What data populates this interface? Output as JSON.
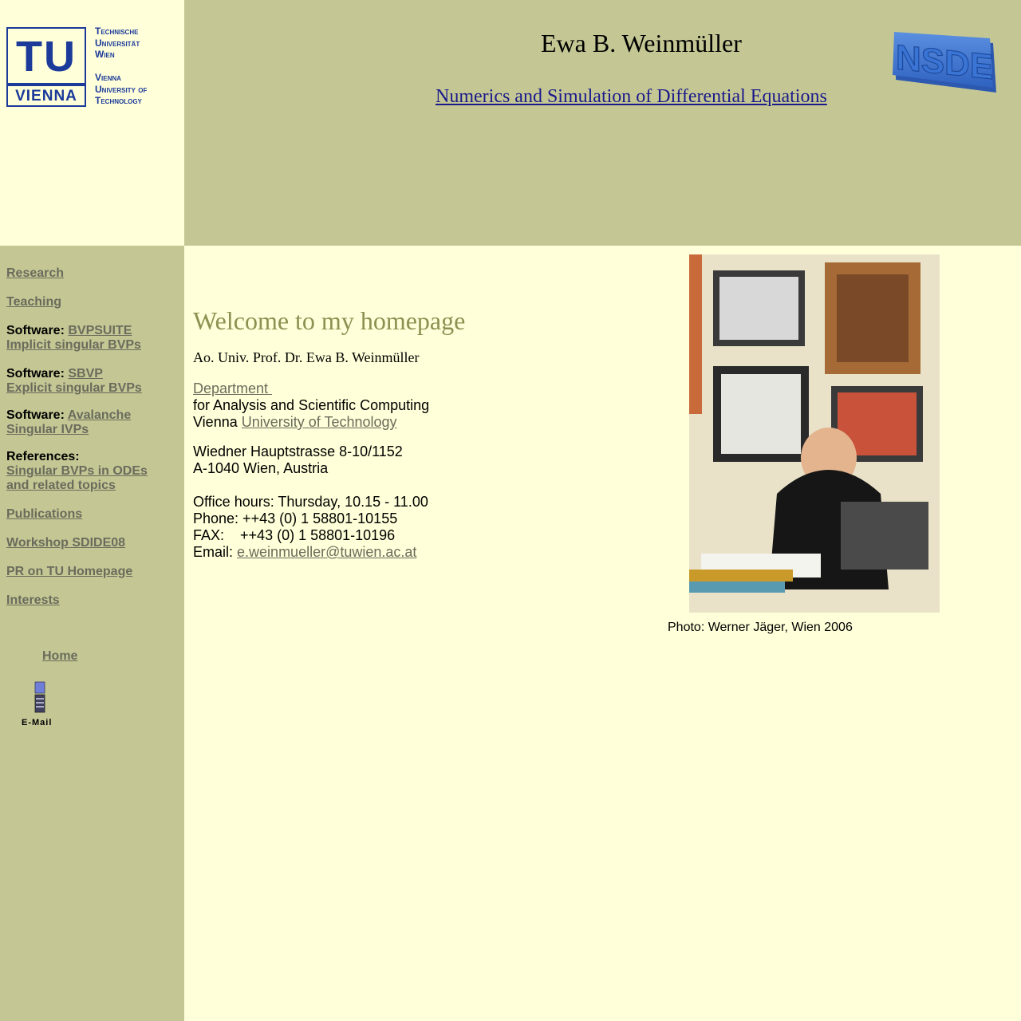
{
  "logo": {
    "tu_letters": "TU",
    "tu_vienna": "VIENNA",
    "lines_de": [
      "Technische",
      "Universität",
      "Wien"
    ],
    "lines_en": [
      "Vienna",
      "University of",
      "Technology"
    ]
  },
  "header": {
    "name": "Ewa B. Weinmüller",
    "subtitle": "Numerics and Simulation of Differential Equations",
    "nsde_logo": "NSDE"
  },
  "nav": {
    "research": "Research",
    "teaching": "Teaching",
    "software_label": "Software:",
    "bvpsuite": "BVPSUITE",
    "bvpsuite_desc": "Implicit singular BVPs",
    "sbvp": "SBVP",
    "sbvp_desc": "Explicit singular BVPs",
    "avalanche": "Avalanche",
    "avalanche_desc": "Singular IVPs",
    "references_label": "References:",
    "references_line1": "Singular BVPs in ODEs",
    "references_line2": "and related topics",
    "publications": "Publications",
    "workshop": "Workshop SDIDE08",
    "pr": "PR on TU Homepage",
    "interests": "Interests",
    "home": "Home",
    "email_icon_label": "E-Mail"
  },
  "main": {
    "welcome": "Welcome to my homepage",
    "professor": "Ao. Univ. Prof. Dr. Ewa B. Weinmüller",
    "department_link": "Department",
    "department_text": "for Analysis and Scientific Computing",
    "vienna": "Vienna",
    "university_link": "University of Technology",
    "street": "Wiedner Hauptstrasse 8-10/1152",
    "city": "A-1040 Wien, Austria",
    "office_hours": "Office hours: Thursday, 10.15 - 11.00",
    "phone": "Phone: ++43 (0) 1 58801-10155",
    "fax_label": "FAX:",
    "fax_value": "++43 (0) 1 58801-10196",
    "email_label": "Email:",
    "email": "e.weinmueller@tuwien.ac.at",
    "photo_caption": "Photo: Werner Jäger, Wien 2006"
  },
  "colors": {
    "olive_bg": "#c4c794",
    "cream_bg": "#ffffd9",
    "tu_blue": "#1b3a9a",
    "link_gray": "#6b6b5c",
    "heading_olive": "#8b9150"
  }
}
